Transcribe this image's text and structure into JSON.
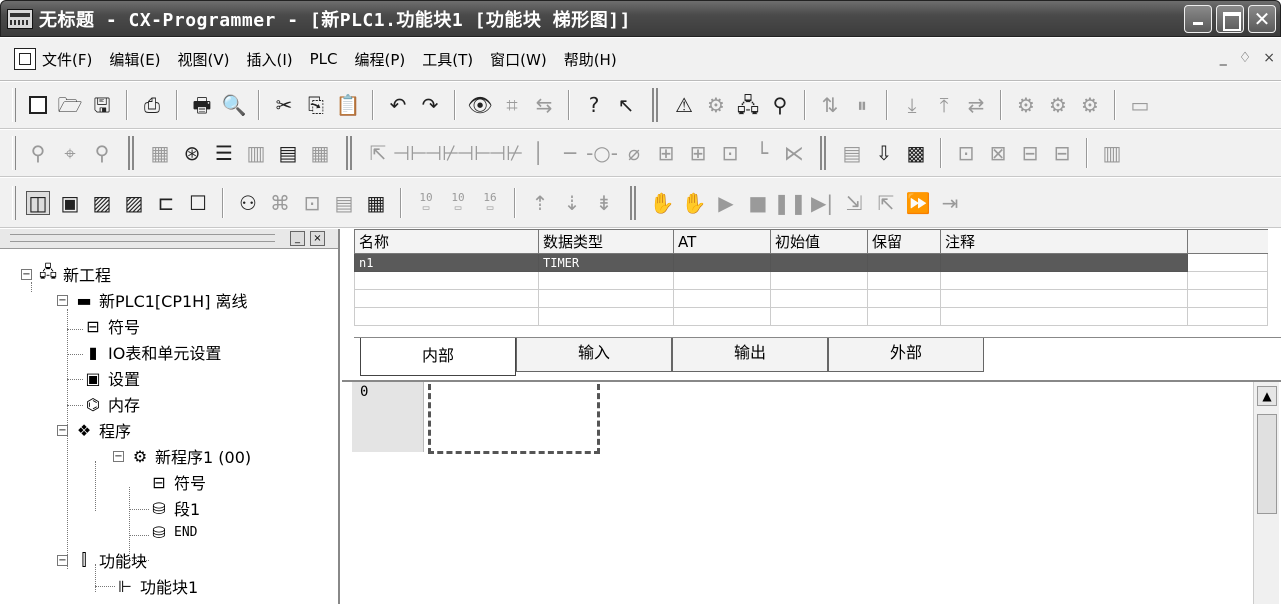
{
  "window": {
    "title": "无标题 - CX-Programmer - [新PLC1.功能块1 [功能块 梯形图]]",
    "close_glyph": "✕"
  },
  "menu": {
    "items": [
      "文件(F)",
      "编辑(E)",
      "视图(V)",
      "插入(I)",
      "PLC",
      "编程(P)",
      "工具(T)",
      "窗口(W)",
      "帮助(H)"
    ],
    "doc_controls": [
      "_",
      "♢",
      "×"
    ]
  },
  "tree": {
    "header_buttons": [
      "_",
      "×"
    ],
    "items": [
      {
        "label": "新工程",
        "icon": "network-icon",
        "expander": "−"
      },
      {
        "label": "新PLC1[CP1H] 离线",
        "icon": "plc-icon",
        "expander": "−"
      },
      {
        "label": "符号",
        "icon": "symbol-icon"
      },
      {
        "label": "IO表和单元设置",
        "icon": "io-table-icon"
      },
      {
        "label": "设置",
        "icon": "settings-icon"
      },
      {
        "label": "内存",
        "icon": "memory-icon"
      },
      {
        "label": "程序",
        "icon": "programs-icon",
        "expander": "−"
      },
      {
        "label": "新程序1 (00)",
        "icon": "program-icon",
        "expander": "−"
      },
      {
        "label": "符号",
        "icon": "symbol-icon"
      },
      {
        "label": "段1",
        "icon": "section-icon"
      },
      {
        "label": "END",
        "icon": "section-icon"
      },
      {
        "label": "功能块",
        "icon": "function-blocks-icon",
        "expander": "−"
      },
      {
        "label": "功能块1",
        "icon": "function-block-icon"
      }
    ]
  },
  "variables": {
    "columns": [
      "名称",
      "数据类型",
      "AT",
      "初始值",
      "保留",
      "注释"
    ],
    "rows": [
      {
        "name": "n1",
        "type": "TIMER",
        "at": "",
        "init": "",
        "retain": "",
        "comment": ""
      }
    ],
    "tabs": [
      "内部",
      "输入",
      "输出",
      "外部"
    ],
    "active_tab": "内部"
  },
  "ladder": {
    "rung_number": "0"
  }
}
